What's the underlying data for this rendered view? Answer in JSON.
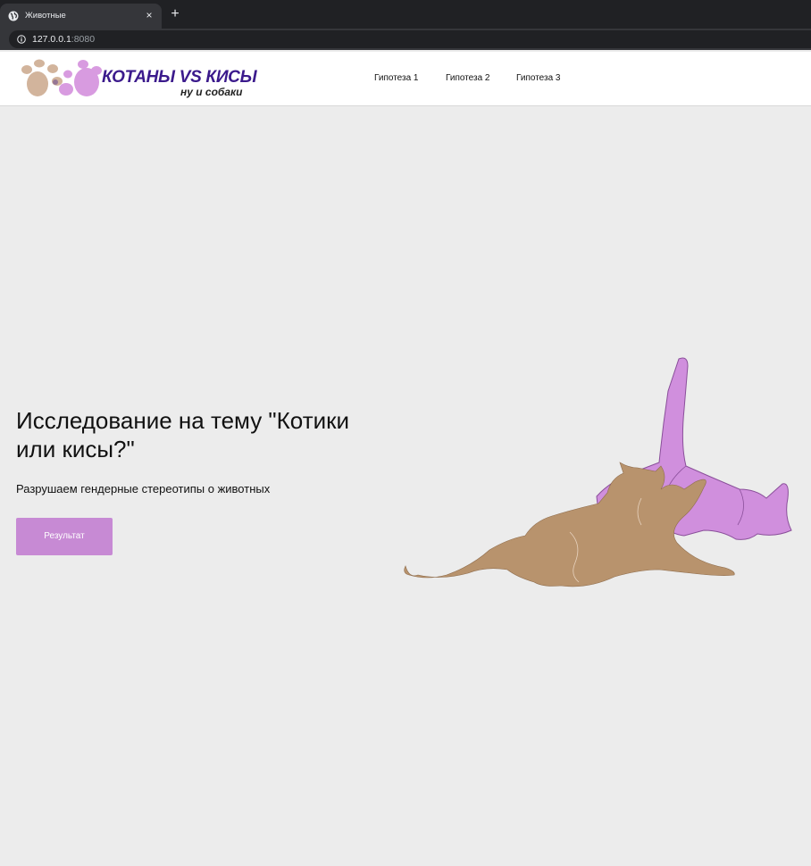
{
  "browser": {
    "tab_title": "Животные",
    "tab_close": "×",
    "new_tab": "+",
    "url_host": "127.0.0.1",
    "url_port": ":8080"
  },
  "site": {
    "logo_main": "КОТАНЫ VS КИСЫ",
    "logo_sub": "ну и собаки",
    "nav": [
      "Гипотеза 1",
      "Гипотеза 2",
      "Гипотеза 3"
    ]
  },
  "hero": {
    "title": "Исследование на тему \"Котики или кисы?\"",
    "subtitle": "Разрушаем гендерные стереотипы о животных",
    "button": "Результат"
  },
  "colors": {
    "accent": "#c78ad4",
    "logo_text": "#3b1a8c",
    "cat_brown": "#b8936d",
    "cat_purple": "#d08fdd",
    "page_bg": "#ececec"
  },
  "icons": {
    "tab_favicon": "globe-icon",
    "omnibox_info": "info-icon",
    "logo": "paw-prints-icon",
    "hero_art": "cats-illustration"
  }
}
